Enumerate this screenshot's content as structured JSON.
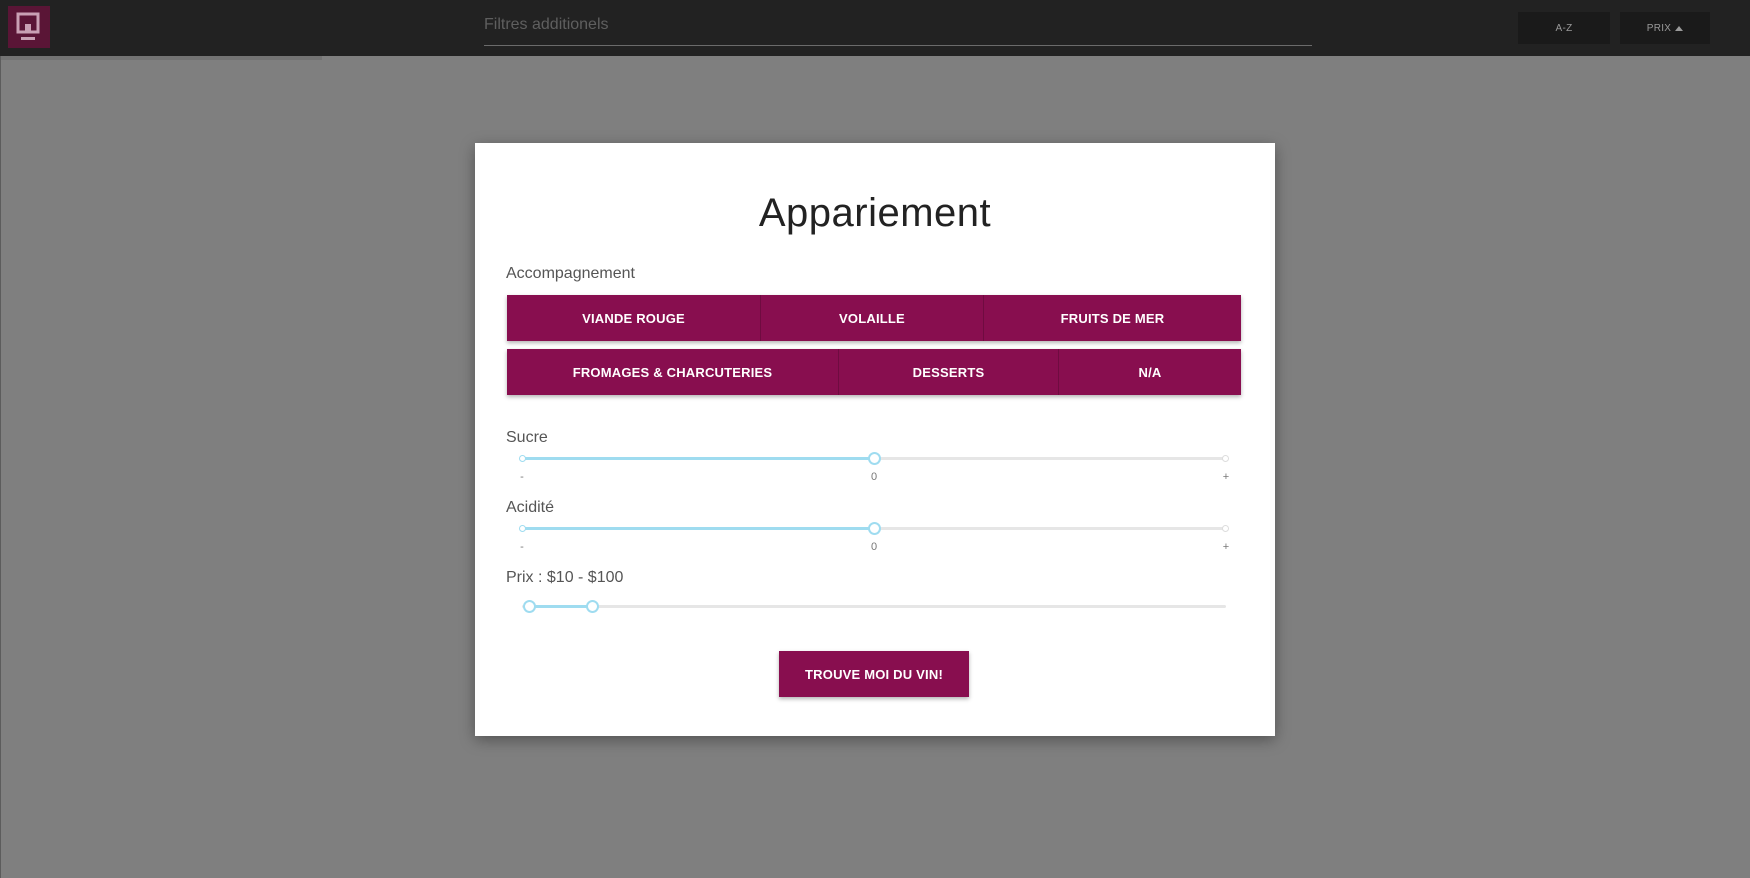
{
  "topbar": {
    "filter_placeholder": "Filtres additionels",
    "sort_az": "A-Z",
    "sort_prix": "PRIX"
  },
  "modal": {
    "title": "Appariement",
    "accompagnement_label": "Accompagnement",
    "row1": [
      "VIANDE ROUGE",
      "VOLAILLE",
      "FRUITS DE MER"
    ],
    "row2": [
      "FROMAGES & CHARCUTERIES",
      "DESSERTS",
      "N/A"
    ],
    "sucre": {
      "label": "Sucre",
      "min_label": "-",
      "mid_label": "0",
      "max_label": "+",
      "value": 0.5
    },
    "acidite": {
      "label": "Acidité",
      "min_label": "-",
      "mid_label": "0",
      "max_label": "+",
      "value": 0.5
    },
    "prix": {
      "label": "Prix : $10 - $100",
      "low": 0.01,
      "high": 0.1
    },
    "submit_label": "TROUVE MOI DU VIN!"
  },
  "colors": {
    "accent": "#880e4f",
    "slider": "#9fdcf0"
  }
}
